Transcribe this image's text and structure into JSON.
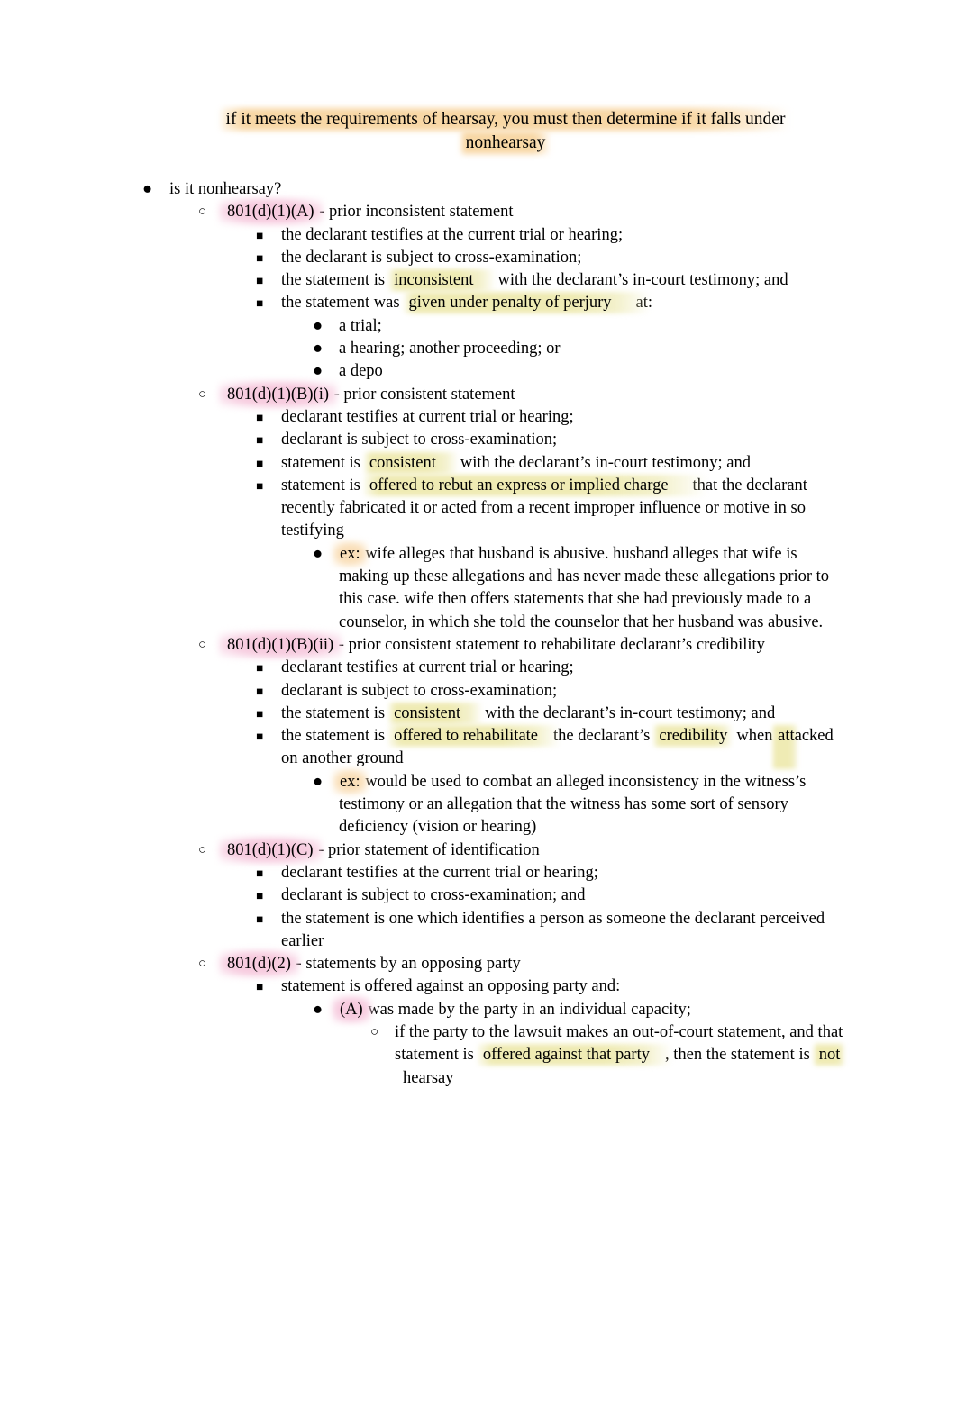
{
  "document": {
    "title_lines": [
      "if it meets the requirements of hearsay, you must then determine if it falls under",
      "nonhearsay"
    ]
  },
  "colors": {
    "highlight_yellow": "#eeeab0",
    "highlight_pink": "#f6c7dc",
    "highlight_orange": "#f8d5a0",
    "text": "#000000",
    "page_background": "#ffffff"
  },
  "bullets": {
    "level1": "●",
    "level2": "○",
    "level3": "■",
    "level4": "●",
    "level5": "○"
  },
  "outline": {
    "root": "is it nonhearsay?",
    "rule_801_d_1_A": {
      "cite": "801(d)(1)(A)",
      "dash_title": " - prior inconsistent statement",
      "elements": [
        "the declarant testifies at the current trial or hearing;",
        "the declarant is subject to cross-examination;"
      ],
      "element3_pre": "the statement is",
      "element3_hl": "inconsistent",
      "element3_post": "with the declarant’s in-court testimony; and",
      "element4_pre": "the statement was",
      "element4_hl": "given under penalty of perjury",
      "element4_post": "at:",
      "venues": [
        "a trial;",
        "a hearing; another proceeding; or",
        "a depo"
      ]
    },
    "rule_801_d_1_B_i": {
      "cite": "801(d)(1)(B)(i)",
      "dash_title": " - prior consistent statement",
      "elements": [
        "declarant testifies at current trial or hearing;",
        "declarant is subject to cross-examination;"
      ],
      "element3_pre": "statement is",
      "element3_hl": "consistent",
      "element3_post": "with the declarant’s in-court testimony; and",
      "element4_pre": "statement is",
      "element4_hl": "offered to rebut an express or implied charge",
      "element4_post": "that the declarant recently fabricated it or acted from a recent improper influence or motive in so testifying",
      "example_label": "ex:",
      "example_text": " wife alleges that husband is abusive. husband alleges that wife is making up these allegations and has never made these allegations prior to this case. wife then offers statements that she had previously made to a counselor, in which she told the counselor that her husband was abusive."
    },
    "rule_801_d_1_B_ii": {
      "cite": "801(d)(1)(B)(ii)",
      "dash_title": " - prior consistent statement to rehabilitate declarant’s credibility",
      "elements": [
        "declarant testifies at current trial or hearing;",
        "declarant is subject to cross-examination;"
      ],
      "element3_pre": "the statement is",
      "element3_hl": "consistent",
      "element3_post": "with the declarant’s in-court testimony; and",
      "element4_pre": "the statement is",
      "element4_hl1": "offered to rehabilitate",
      "element4_mid": "the declarant’s",
      "element4_hl2": "credibility",
      "element4_post": "when",
      "element4_hl3": "attacked on another ground",
      "example_label": "ex:",
      "example_text": " would be used to combat an alleged inconsistency in the witness’s testimony or an allegation that the witness has some sort of sensory deficiency (vision or hearing)"
    },
    "rule_801_d_1_C": {
      "cite": "801(d)(1)(C)",
      "dash_title": " - prior statement of identification",
      "elements": [
        "declarant testifies at the current trial or hearing;",
        "declarant is subject to cross-examination; and",
        "the statement is one which identifies a person as someone the declarant perceived earlier"
      ]
    },
    "rule_801_d_2": {
      "cite": "801(d)(2)",
      "dash_title": " - statements by an opposing party",
      "element1": "statement is offered against an opposing party and:",
      "sub_a_label": "(A)",
      "sub_a_text": " was made by the party in an individual capacity;",
      "detail_pre": "if the party to the lawsuit makes an out-of-court statement, and that statement is",
      "detail_hl1": "offered against that party",
      "detail_mid": ", then the statement is",
      "detail_hl2": "not",
      "detail_post": "hearsay"
    }
  }
}
